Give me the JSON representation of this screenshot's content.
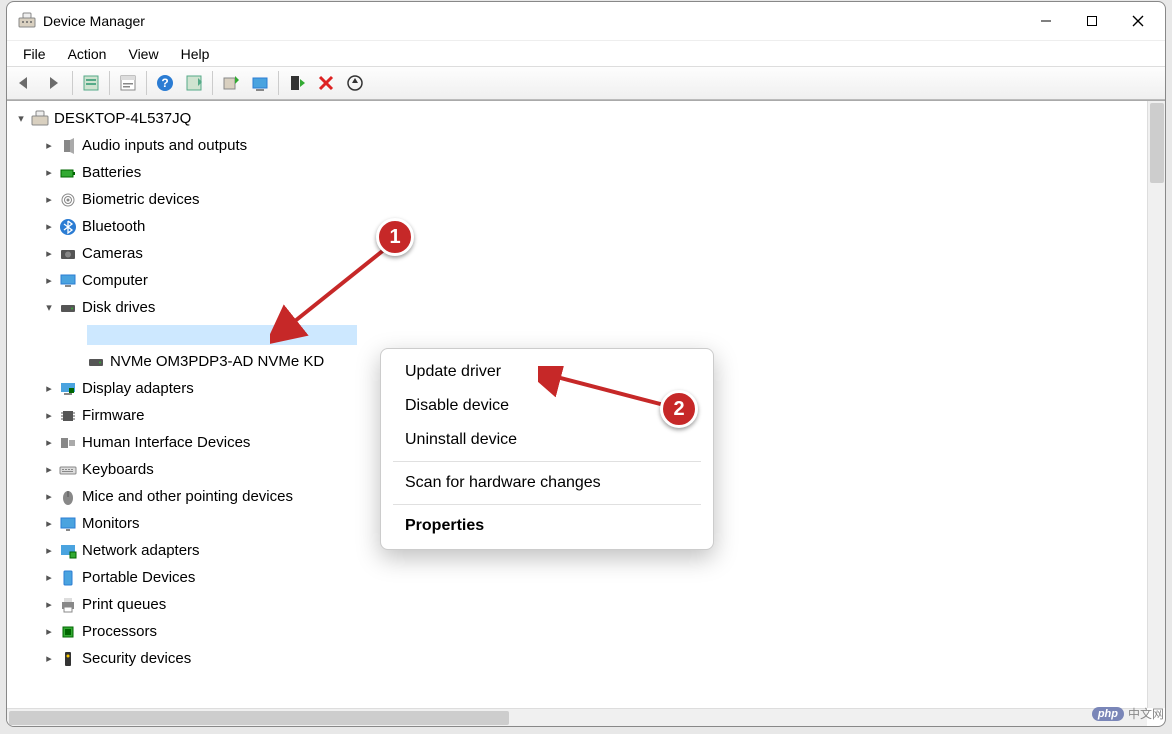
{
  "window": {
    "title": "Device Manager"
  },
  "menubar": {
    "items": [
      "File",
      "Action",
      "View",
      "Help"
    ]
  },
  "toolbar": {
    "back": "Back",
    "forward": "Forward",
    "show_hidden": "Show hidden devices",
    "properties": "Properties",
    "help": "Help",
    "scan": "Scan for hardware changes",
    "update": "Update driver",
    "add_legacy": "Add legacy hardware",
    "enable": "Enable device",
    "uninstall": "Uninstall device",
    "devices_by_type": "Devices by type"
  },
  "tree": {
    "root": {
      "label": "DESKTOP-4L537JQ",
      "expanded": true
    },
    "children": [
      {
        "label": "Audio inputs and outputs",
        "expanded": false,
        "icon": "speaker"
      },
      {
        "label": "Batteries",
        "expanded": false,
        "icon": "battery"
      },
      {
        "label": "Biometric devices",
        "expanded": false,
        "icon": "fingerprint"
      },
      {
        "label": "Bluetooth",
        "expanded": false,
        "icon": "bluetooth"
      },
      {
        "label": "Cameras",
        "expanded": false,
        "icon": "camera"
      },
      {
        "label": "Computer",
        "expanded": false,
        "icon": "computer"
      },
      {
        "label": "Disk drives",
        "expanded": true,
        "icon": "disk",
        "children": [
          {
            "label": "",
            "selected": true,
            "icon": "disk"
          },
          {
            "label": "NVMe OM3PDP3-AD NVMe KD",
            "icon": "disk"
          }
        ]
      },
      {
        "label": "Display adapters",
        "expanded": false,
        "icon": "display"
      },
      {
        "label": "Firmware",
        "expanded": false,
        "icon": "chip"
      },
      {
        "label": "Human Interface Devices",
        "expanded": false,
        "icon": "hid"
      },
      {
        "label": "Keyboards",
        "expanded": false,
        "icon": "keyboard"
      },
      {
        "label": "Mice and other pointing devices",
        "expanded": false,
        "icon": "mouse"
      },
      {
        "label": "Monitors",
        "expanded": false,
        "icon": "monitor"
      },
      {
        "label": "Network adapters",
        "expanded": false,
        "icon": "network"
      },
      {
        "label": "Portable Devices",
        "expanded": false,
        "icon": "portable"
      },
      {
        "label": "Print queues",
        "expanded": false,
        "icon": "printer"
      },
      {
        "label": "Processors",
        "expanded": false,
        "icon": "cpu"
      },
      {
        "label": "Security devices",
        "expanded": false,
        "icon": "security"
      }
    ]
  },
  "context_menu": {
    "items": [
      {
        "label": "Update driver"
      },
      {
        "label": "Disable device"
      },
      {
        "label": "Uninstall device"
      },
      {
        "sep": true
      },
      {
        "label": "Scan for hardware changes"
      },
      {
        "sep": true
      },
      {
        "label": "Properties",
        "bold": true
      }
    ]
  },
  "annotations": {
    "badge1": "1",
    "badge2": "2"
  },
  "watermark": {
    "php": "php",
    "text": "中文网"
  }
}
